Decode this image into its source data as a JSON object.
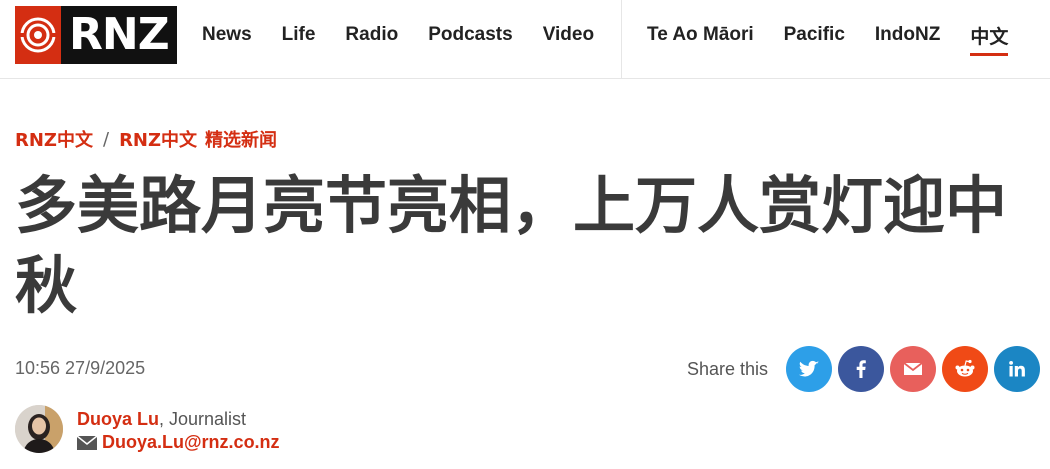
{
  "header": {
    "logo_text": "RNZ",
    "nav_primary": [
      {
        "label": "News"
      },
      {
        "label": "Life"
      },
      {
        "label": "Radio"
      },
      {
        "label": "Podcasts"
      },
      {
        "label": "Video"
      }
    ],
    "nav_secondary": [
      {
        "label": "Te Ao Māori"
      },
      {
        "label": "Pacific"
      },
      {
        "label": "IndoNZ"
      },
      {
        "label": "中文",
        "active": true
      }
    ]
  },
  "breadcrumb": {
    "first": "RNZ中文",
    "separator": "/",
    "second": "RNZ中文",
    "sub": "精选新闻"
  },
  "article": {
    "title": "多美路月亮节亮相，上万人赏灯迎中秋",
    "timestamp": "10:56 27/9/2025"
  },
  "share": {
    "label": "Share this",
    "buttons": [
      {
        "name": "twitter-icon",
        "color": "#2d9fe8"
      },
      {
        "name": "facebook-icon",
        "color": "#3b579d"
      },
      {
        "name": "email-icon",
        "color": "#e8605c"
      },
      {
        "name": "reddit-icon",
        "color": "#f04a16"
      },
      {
        "name": "linkedin-icon",
        "color": "#1b86c4"
      }
    ]
  },
  "author": {
    "name": "Duoya Lu",
    "role": ", Journalist",
    "email": "Duoya.Lu@rnz.co.nz"
  },
  "colors": {
    "brand_red": "#d42e12",
    "title_text": "#3a3a3a"
  }
}
